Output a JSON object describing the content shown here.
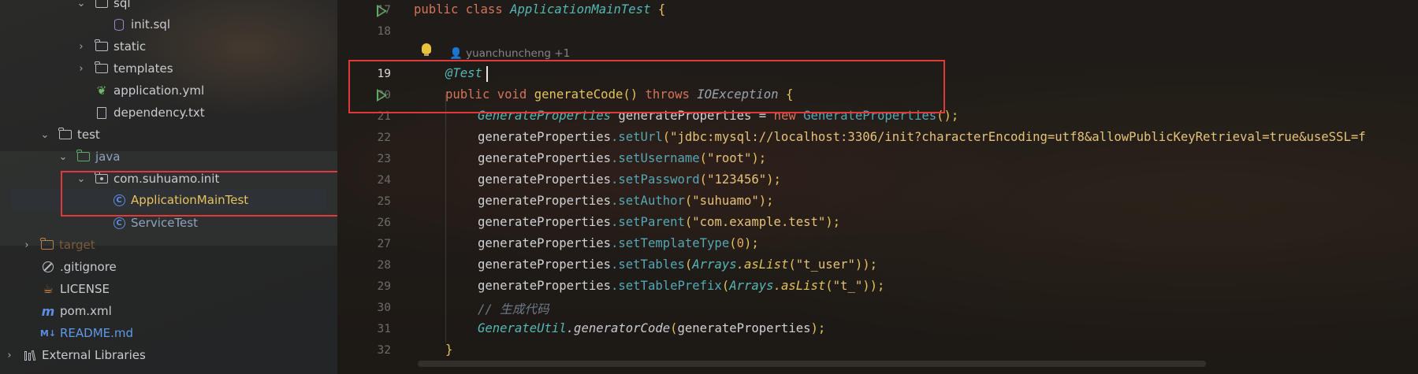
{
  "project_tree": {
    "items": [
      {
        "label": "sql"
      },
      {
        "label": "init.sql"
      },
      {
        "label": "static"
      },
      {
        "label": "templates"
      },
      {
        "label": "application.yml"
      },
      {
        "label": "dependency.txt"
      },
      {
        "label": "test"
      },
      {
        "label": "java"
      },
      {
        "label": "com.suhuamo.init"
      },
      {
        "label": "ApplicationMainTest"
      },
      {
        "label": "ServiceTest"
      },
      {
        "label": "target"
      },
      {
        "label": ".gitignore"
      },
      {
        "label": "LICENSE"
      },
      {
        "label": "pom.xml"
      },
      {
        "label": "README.md"
      },
      {
        "label": "External Libraries"
      }
    ],
    "md_badge": "M↓"
  },
  "editor": {
    "author_hint": "yuanchuncheng +1",
    "line_numbers": [
      "17",
      "18",
      "19",
      "20",
      "21",
      "22",
      "23",
      "24",
      "25",
      "26",
      "27",
      "28",
      "29",
      "30",
      "31",
      "32"
    ],
    "current_line": "19",
    "code": {
      "l17": {
        "kw1": "public",
        "kw2": "class",
        "name": "ApplicationMainTest",
        "brace": "{"
      },
      "l19": {
        "annotation": "@Test"
      },
      "l20": {
        "kw1": "public",
        "kw2": "void",
        "method": "generateCode",
        "parens": "()",
        "kw3": "throws",
        "exception": "IOException",
        "brace": "{"
      },
      "l21": {
        "type": "GenerateProperties",
        "var": "generateProperties",
        "eq": "=",
        "kw": "new",
        "ctor": "GenerateProperties",
        "end": "();"
      },
      "l22": {
        "obj": "generateProperties",
        "method": ".setUrl",
        "arg": "\"jdbc:mysql://localhost:3306/init?characterEncoding=utf8&allowPublicKeyRetrieval=true&useSSL=f"
      },
      "l23": {
        "obj": "generateProperties",
        "method": ".setUsername",
        "arg": "\"root\"",
        "end": ");"
      },
      "l24": {
        "obj": "generateProperties",
        "method": ".setPassword",
        "arg": "\"123456\"",
        "end": ");"
      },
      "l25": {
        "obj": "generateProperties",
        "method": ".setAuthor",
        "arg": "\"suhuamo\"",
        "end": ");"
      },
      "l26": {
        "obj": "generateProperties",
        "method": ".setParent",
        "arg": "\"com.example.test\"",
        "end": ");"
      },
      "l27": {
        "obj": "generateProperties",
        "method": ".setTemplateType",
        "arg": "0",
        "end": ");"
      },
      "l28": {
        "obj": "generateProperties",
        "method": ".setTables",
        "cls": "Arrays",
        "call": ".asList",
        "arg": "\"t_user\"",
        "end": "));"
      },
      "l29": {
        "obj": "generateProperties",
        "method": ".setTablePrefix",
        "cls": "Arrays",
        "call": ".asList",
        "arg": "\"t_\"",
        "end": "));"
      },
      "l30": {
        "comment": "// 生成代码"
      },
      "l31": {
        "cls": "GenerateUtil",
        "method": ".generatorCode",
        "arg": "generateProperties",
        "end": ");"
      },
      "l32": {
        "brace": "}"
      }
    }
  },
  "colors": {
    "highlight_box": "#e0393a",
    "keyword": "#d5735a",
    "class_name": "#54b9b5",
    "method": "#e3c35c",
    "string": "#e5c27a",
    "run_gutter": "#5faa6a"
  }
}
